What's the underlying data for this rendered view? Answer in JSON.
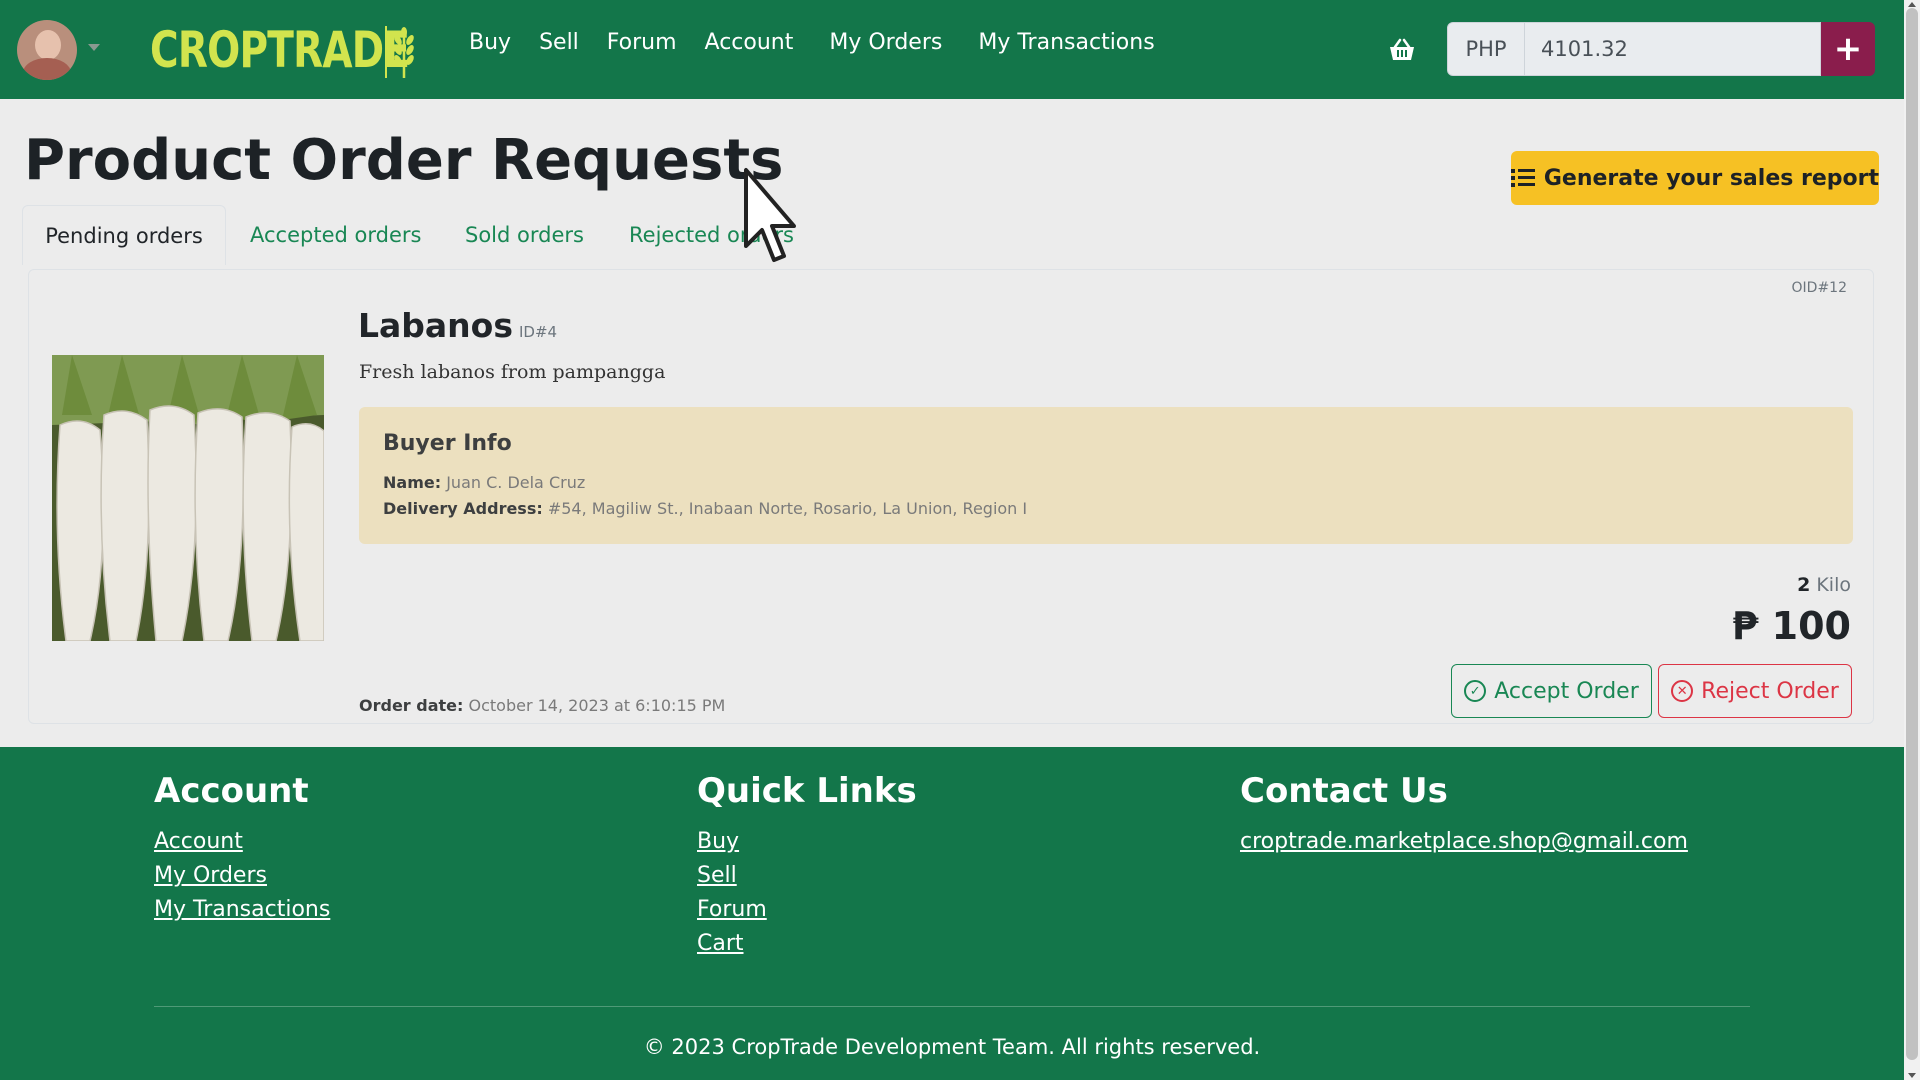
{
  "header": {
    "brand": "CROPTRADE",
    "nav": [
      {
        "label": "Buy"
      },
      {
        "label": "Sell"
      },
      {
        "label": "Forum"
      },
      {
        "label": "Account"
      },
      {
        "label": "My Orders"
      },
      {
        "label": "My Transactions"
      }
    ],
    "balance": {
      "currency": "PHP",
      "amount": "4101.32",
      "add_label": "+"
    }
  },
  "page": {
    "title": "Product Order Requests",
    "report_button": "Generate your sales report",
    "tabs": [
      {
        "label": "Pending orders",
        "active": true
      },
      {
        "label": "Accepted orders",
        "active": false
      },
      {
        "label": "Sold orders",
        "active": false
      },
      {
        "label": "Rejected orders",
        "active": false
      }
    ]
  },
  "order": {
    "oid": "OID#12",
    "product_name": "Labanos",
    "product_id": "ID#4",
    "description": "Fresh labanos from pampangga",
    "buyer": {
      "title": "Buyer Info",
      "name_label": "Name:",
      "name": "Juan C. Dela Cruz",
      "address_label": "Delivery Address:",
      "address": "#54, Magiliw St., Inabaan Norte, Rosario, La Union, Region I"
    },
    "quantity": "2",
    "unit": "Kilo",
    "price": "₱ 100",
    "order_date_label": "Order date:",
    "order_date": "October 14, 2023 at 6:10:15 PM",
    "accept_label": "Accept Order",
    "reject_label": "Reject Order"
  },
  "footer": {
    "account": {
      "title": "Account",
      "links": [
        "Account",
        "My Orders",
        "My Transactions"
      ]
    },
    "quick_links": {
      "title": "Quick Links",
      "links": [
        "Buy",
        "Sell",
        "Forum",
        "Cart"
      ]
    },
    "contact": {
      "title": "Contact Us",
      "email": "croptrade.marketplace.shop@gmail.com"
    },
    "copyright": "© 2023 CropTrade Development Team. All rights reserved."
  },
  "colors": {
    "primary_green": "#13764a",
    "brand_yellow": "#d2e44e",
    "report_button": "#f6c124",
    "add_funds_button": "#8a1d4c",
    "buyer_box": "#ece0bf",
    "accept": "#198754",
    "reject": "#dc3545"
  },
  "icons": {
    "brand_logo": "wheat-icon",
    "cart": "basket-icon",
    "report": "list-icon",
    "accept": "check-circle-icon",
    "reject": "x-circle-icon"
  }
}
